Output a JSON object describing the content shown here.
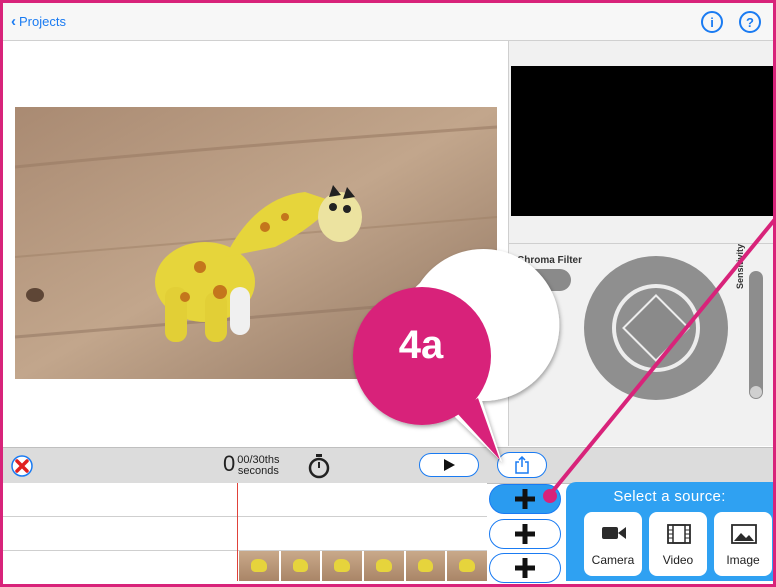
{
  "header": {
    "back_label": "Projects",
    "info_label": "i",
    "help_label": "?"
  },
  "right_panel": {
    "chroma_filter_label": "Chroma Filter",
    "sensitivity_label": "Sensitivity"
  },
  "toolbar": {
    "frame_number": "0",
    "frame_fraction": "00/30ths",
    "seconds_label": "seconds"
  },
  "source_picker": {
    "title": "Select a source:",
    "options": [
      {
        "label": "Camera",
        "icon": "video-camera-icon"
      },
      {
        "label": "Video",
        "icon": "film-strip-icon"
      },
      {
        "label": "Image",
        "icon": "image-icon"
      }
    ]
  },
  "callout": {
    "label": "4a",
    "color": "#d8237a"
  },
  "colors": {
    "accent": "#1a7bf2",
    "annotation": "#d8237a",
    "picker_bg": "#2fa1f2"
  }
}
